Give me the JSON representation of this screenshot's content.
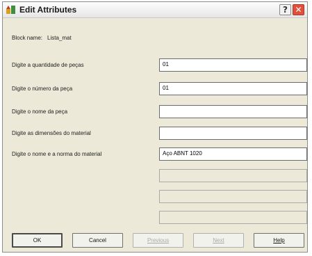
{
  "window": {
    "title": "Edit Attributes",
    "help_glyph": "?",
    "close_glyph": "✕"
  },
  "block": {
    "label": "Block name:",
    "value": "Lista_mat"
  },
  "attributes": [
    {
      "label": "Digite a quantidade de peças",
      "value": "01"
    },
    {
      "label": "Digite o número da peça",
      "value": "01"
    },
    {
      "label": "Digite o nome da peça",
      "value": ""
    },
    {
      "label": "Digite as dimensões do material",
      "value": ""
    },
    {
      "label": "Digite o nome e a norma do material",
      "value": "Aço ABNT 1020"
    }
  ],
  "buttons": {
    "ok": "OK",
    "cancel": "Cancel",
    "previous": "Previous",
    "next": "Next",
    "help": "Help"
  },
  "colors": {
    "dialog_bg": "#ece9d8",
    "close_button": "#e0503c"
  }
}
